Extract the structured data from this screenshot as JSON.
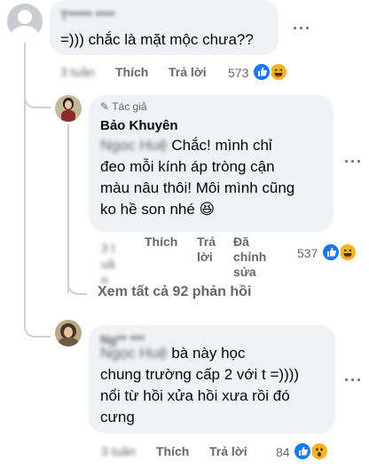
{
  "comments": [
    {
      "author": "T***** ****",
      "text": "=))) chắc là mặt mộc chưa??",
      "time": "3 tuần",
      "like_label": "Thích",
      "reply_label": "Trả lời",
      "reaction_count": "573",
      "more_icon": "more-horizontal-icon"
    },
    {
      "author_badge": "Tác giả",
      "author": "Bảo Khuyên",
      "text_prefix": "Ngoc Huệ",
      "text_line1": " Chắc! mình chỉ",
      "text_line2": "đeo mỗi kính áp tròng cận",
      "text_line3": "màu nâu thôi! Môi mình cũng",
      "text_line4": "ko hề son nhé 😆",
      "time": "3 tuần",
      "like_label": "Thích",
      "reply_label_1": "Trả",
      "reply_label_2": "lời",
      "edited_label_1": "Đã",
      "edited_label_2": "chỉnh",
      "edited_label_3": "sửa",
      "reaction_count": "537"
    }
  ],
  "see_more": "Xem tất cả 92 phản hồi",
  "comment3": {
    "author": "Ng** ***",
    "text_prefix": "Ngọc Huệ",
    "text_line1": " bà này học",
    "text_line2": "chung trường cấp 2 với t =))))",
    "text_line3": "nổi từ hồi xửa hồi xưa rồi đó",
    "text_line4": "cưng",
    "time": "3 tuần",
    "like_label": "Thích",
    "reply_label": "Trả lời",
    "reaction_count": "84"
  },
  "colors": {
    "bubble": "#f0f2f5",
    "like_blue": "#1877f2",
    "haha_yellow": "#f7b125",
    "meta_gray": "#65676b"
  }
}
